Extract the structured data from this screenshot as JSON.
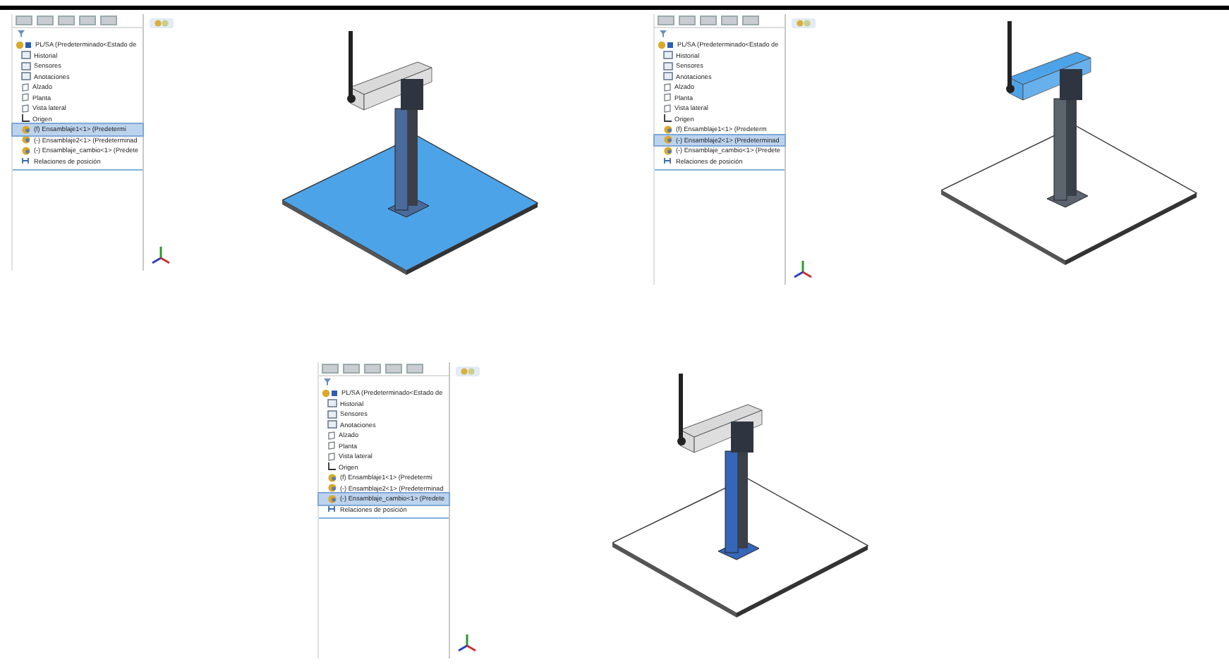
{
  "screens": [
    {
      "plate_highlighted": true,
      "arm_highlighted": false,
      "base_highlighted": false,
      "tree": [
        {
          "label": "PL/SA (Predeterminado<Estado de",
          "kind": "part",
          "selected": false,
          "children": [
            {
              "label": "Historial",
              "kind": "folder",
              "selected": false
            },
            {
              "label": "Sensores",
              "kind": "folder",
              "selected": false
            },
            {
              "label": "Anotaciones",
              "kind": "folder",
              "selected": false
            },
            {
              "label": "Alzado",
              "kind": "plane",
              "selected": false
            },
            {
              "label": "Planta",
              "kind": "plane",
              "selected": false
            },
            {
              "label": "Vista lateral",
              "kind": "plane",
              "selected": false
            },
            {
              "label": "Origen",
              "kind": "origin",
              "selected": false
            },
            {
              "label": "(f) Ensamblaje1<1> (Predetermi",
              "kind": "assembly",
              "selected": true
            },
            {
              "label": "(-) Ensamblaje2<1> (Predeterminad",
              "kind": "assembly",
              "selected": false
            },
            {
              "label": "(-) Ensamblaje_cambio<1> (Predete",
              "kind": "assembly",
              "selected": false
            },
            {
              "label": "Relaciones de posición",
              "kind": "mates",
              "selected": false
            }
          ]
        }
      ]
    },
    {
      "plate_highlighted": false,
      "arm_highlighted": true,
      "base_highlighted": false,
      "tree": [
        {
          "label": "PL/SA (Predeterminado<Estado de",
          "kind": "part",
          "selected": false,
          "children": [
            {
              "label": "Historial",
              "kind": "folder",
              "selected": false
            },
            {
              "label": "Sensores",
              "kind": "folder",
              "selected": false
            },
            {
              "label": "Anotaciones",
              "kind": "folder",
              "selected": false
            },
            {
              "label": "Alzado",
              "kind": "plane",
              "selected": false
            },
            {
              "label": "Planta",
              "kind": "plane",
              "selected": false
            },
            {
              "label": "Vista lateral",
              "kind": "plane",
              "selected": false
            },
            {
              "label": "Origen",
              "kind": "origin",
              "selected": false
            },
            {
              "label": "(f) Ensamblaje1<1> (Predeterm",
              "kind": "assembly",
              "selected": false
            },
            {
              "label": "(-) Ensamblaje2<1> (Predeterminad",
              "kind": "assembly",
              "selected": true
            },
            {
              "label": "(-) Ensamblaje_cambio<1> (Predete",
              "kind": "assembly",
              "selected": false
            },
            {
              "label": "Relaciones de posición",
              "kind": "mates",
              "selected": false
            }
          ]
        }
      ]
    },
    {
      "plate_highlighted": false,
      "arm_highlighted": false,
      "base_highlighted": true,
      "tree": [
        {
          "label": "PL/SA (Predeterminado<Estado de",
          "kind": "part",
          "selected": false,
          "children": [
            {
              "label": "Historial",
              "kind": "folder",
              "selected": false
            },
            {
              "label": "Sensores",
              "kind": "folder",
              "selected": false
            },
            {
              "label": "Anotaciones",
              "kind": "folder",
              "selected": false
            },
            {
              "label": "Alzado",
              "kind": "plane",
              "selected": false
            },
            {
              "label": "Planta",
              "kind": "plane",
              "selected": false
            },
            {
              "label": "Vista lateral",
              "kind": "plane",
              "selected": false
            },
            {
              "label": "Origen",
              "kind": "origin",
              "selected": false
            },
            {
              "label": "(f) Ensamblaje1<1> (Predetermi",
              "kind": "assembly",
              "selected": false
            },
            {
              "label": "(-) Ensamblaje2<1> (Predeterminad",
              "kind": "assembly",
              "selected": false
            },
            {
              "label": "(-) Ensamblaje_cambio<1> (Predete",
              "kind": "assembly",
              "selected": true
            },
            {
              "label": "Relaciones de posición",
              "kind": "mates",
              "selected": false
            }
          ]
        }
      ]
    }
  ]
}
